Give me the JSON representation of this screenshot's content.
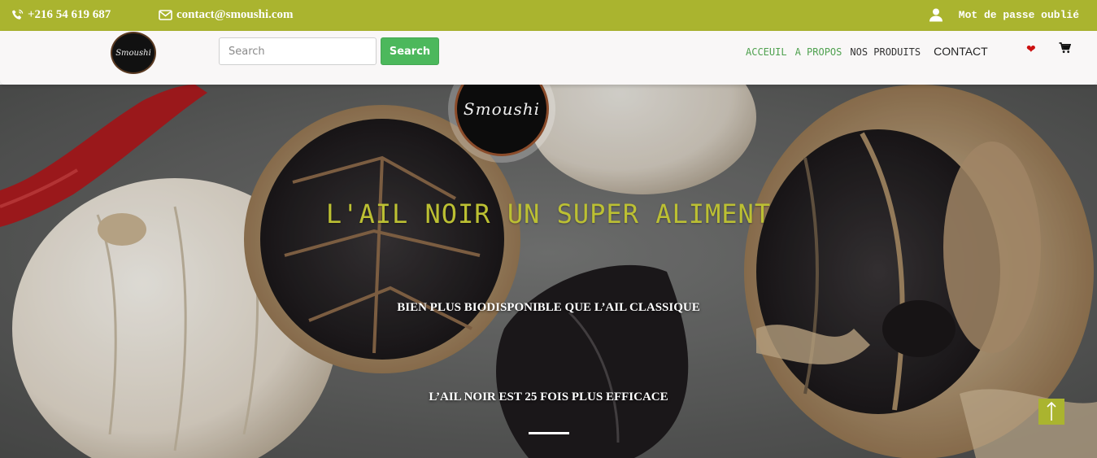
{
  "topbar": {
    "phone": "+216 54 619 687",
    "email": "contact@smoushi.com",
    "account_link": "Mot de passe oublié",
    "icons": [
      "phone-icon",
      "envelope-icon",
      "user-icon"
    ],
    "color": "#aab42f"
  },
  "brand": {
    "logo_text": "Smoushi"
  },
  "search": {
    "placeholder": "Search",
    "value": "",
    "button_label": "Search"
  },
  "nav": {
    "links": [
      {
        "label": "ACCEUIL",
        "active": true
      },
      {
        "label": "A PROPOS",
        "active": true
      },
      {
        "label": "NOS PRODUITS",
        "active": false
      },
      {
        "label": "CONTACT",
        "active": false
      }
    ],
    "icons": [
      "heart-icon",
      "cart-icon"
    ]
  },
  "hero": {
    "title": "L'AIL NOIR UN SUPER ALIMENT",
    "subtitle_1": "BIEN PLUS BIODISPONIBLE QUE L’AIL CLASSIQUE",
    "subtitle_2": "L’AIL NOIR EST 25 FOIS PLUS EFFICACE",
    "scroll_top_icon": "arrow-up-icon",
    "accent_color": "#bcc033"
  }
}
